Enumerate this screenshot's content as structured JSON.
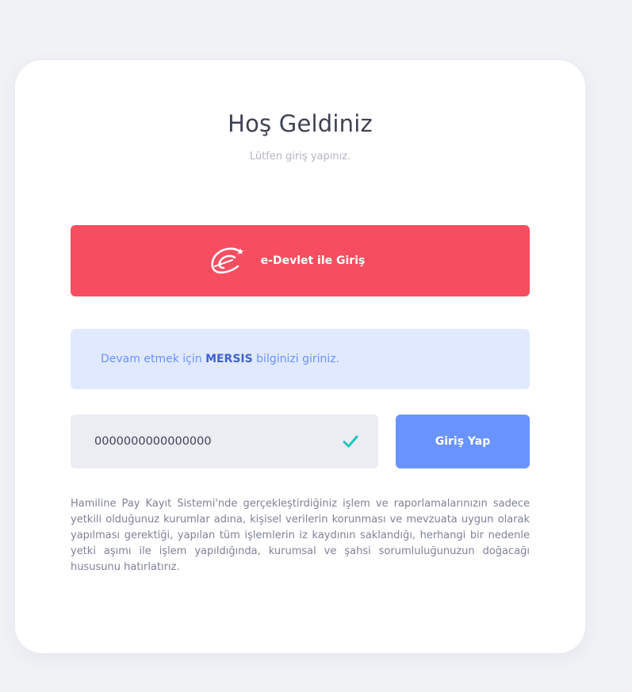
{
  "login": {
    "title": "Hoş Geldiniz",
    "subtitle": "Lütfen giriş yapınız.",
    "edevlet_button": {
      "label": "e-Devlet ile Giriş",
      "icon": "e-devlet-logo-icon",
      "color": "#f64e60"
    },
    "info": {
      "prefix": "Devam etmek için ",
      "highlight": "MERSIS",
      "suffix": " bilginizi giriniz.",
      "color": "#6993ff"
    },
    "mersis_input": {
      "value": "0000000000000000",
      "valid_icon": "check-icon",
      "valid_color": "#1bc5bd"
    },
    "submit_button": {
      "label": "Giriş Yap",
      "color": "#6993ff"
    },
    "disclaimer": "Hamiline Pay Kayıt Sistemi'nde gerçekleştirdiğiniz işlem ve raporlamalarınızın sadece yetkili olduğunuz kurumlar adına, kişisel verilerin korunması ve mevzuata uygun olarak yapılması gerektiği, yapılan tüm işlemlerin iz kaydının saklandığı, herhangi bir nedenle yetki aşımı ile işlem yapıldığında, kurumsal ve şahsi sorumluluğunuzun doğacağı hususunu hatırlatırız."
  }
}
